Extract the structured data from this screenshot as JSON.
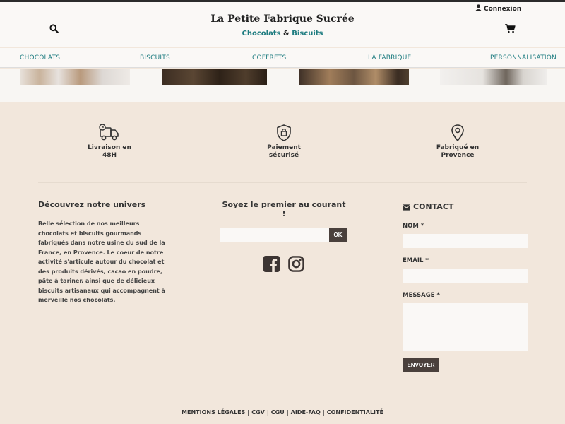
{
  "header": {
    "login_label": "Connexion",
    "brand_title": "La Petite Fabrique Sucrée",
    "brand_sub_left": "Chocolats",
    "brand_sub_amp": "&",
    "brand_sub_right": "Biscuits",
    "search_icon": "search-icon",
    "cart_icon": "shopping-cart-icon",
    "user_icon": "user-icon"
  },
  "nav": {
    "items": [
      "CHOCOLATS",
      "BISCUITS",
      "COFFRETS",
      "LA FABRIQUE",
      "PERSONNALISATION"
    ]
  },
  "features": [
    {
      "icon": "delivery-truck-icon",
      "line1": "Livraison en",
      "line2": "48H"
    },
    {
      "icon": "secure-shield-icon",
      "line1": "Paiement",
      "line2": "sécurisé"
    },
    {
      "icon": "location-pin-icon",
      "line1": "Fabriqué en",
      "line2": "Provence"
    }
  ],
  "about": {
    "title": "Découvrez notre univers",
    "text": "Belle sélection de nos meilleurs chocolats et biscuits gourmands fabriqués dans notre usine du sud de la France, en Provence. Le coeur de notre activité s'articule autour du chocolat et des produits dérivés, cacao en poudre, pâte à tariner, ainsi que de délicieux biscuits artisanaux qui accompagnent à merveille nos chocolats."
  },
  "newsletter": {
    "title": "Soyez le premier au courant !",
    "input_value": "",
    "ok_label": "OK",
    "facebook_icon": "facebook-icon",
    "instagram_icon": "instagram-icon"
  },
  "contact": {
    "title": "CONTACT",
    "name_label": "NOM *",
    "email_label": "EMAIL *",
    "message_label": "MESSAGE *",
    "name_value": "",
    "email_value": "",
    "message_value": "",
    "send_label": "ENVOYER"
  },
  "footer": {
    "links": [
      "MENTIONS LÉGALES",
      "CGV",
      "CGU",
      "AIDE-FAQ",
      "CONFIDENTIALITÉ"
    ],
    "separator": "|"
  },
  "colors": {
    "accent_teal": "#1e7c80",
    "button_dark": "#4a403c",
    "footer_bg": "#f2e7dc",
    "header_bg": "#faf8f6"
  }
}
